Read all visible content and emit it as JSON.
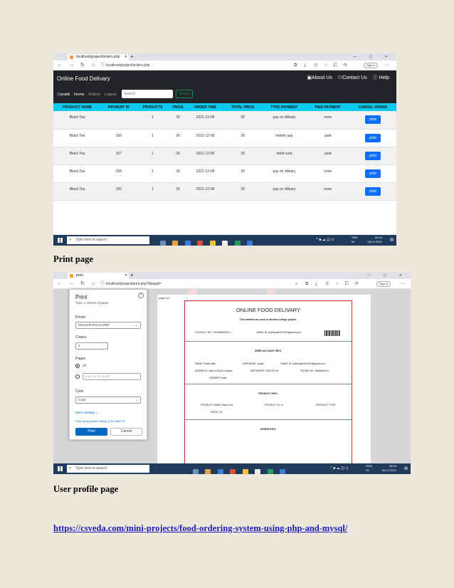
{
  "browser1": {
    "tab_title": "localhost/project/orders.php",
    "url": "localhost/project/orders.php",
    "sign_in": "Sign in"
  },
  "app": {
    "brand": "Online Food Delivary",
    "about": "About Us",
    "contact": "Contact Us",
    "help": "Help",
    "user": "pratik",
    "home": "Home",
    "orders": "Orders",
    "logout": "Logout",
    "search_placeholder": "Search",
    "search_button": "Search"
  },
  "orders_table": {
    "headers": [
      "PRODUCT NAME",
      "PAYMENT ID",
      "PRODUCTS",
      "PRICE",
      "ORDER TIME",
      "TOTAL PRICE",
      "TYPE PAYMENT",
      "PAID PAYMENT",
      "CANCEL ORDER"
    ],
    "rows": [
      [
        "Black Tea",
        "",
        "1",
        "30",
        "2021-12-08",
        "30",
        "pay on dilivary",
        "none",
        "print"
      ],
      [
        "Black Tea",
        "156",
        "1",
        "30",
        "2021-12-08",
        "30",
        "mobile pay",
        "paid",
        "print"
      ],
      [
        "Black Tea",
        "157",
        "1",
        "30",
        "2021-12-08",
        "30",
        "debit card",
        "paid",
        "print"
      ],
      [
        "Black Tea",
        "158",
        "1",
        "30",
        "2021-12-08",
        "30",
        "pay on dilivary",
        "none",
        "print"
      ],
      [
        "Black Tea",
        "159",
        "1",
        "30",
        "2021-12-08",
        "30",
        "pay on dilivary",
        "none",
        "print"
      ]
    ]
  },
  "taskbar": {
    "search": "Type here to search",
    "lang": "ENG",
    "region": "IN",
    "time1": "08:18",
    "date": "08-12-2021",
    "time2": "08:19"
  },
  "caption_print": "Print page",
  "browser2": {
    "tab_title": "print",
    "url": "localhost/project/print.php?0payid="
  },
  "print_dialog": {
    "title": "Print",
    "subtitle": "Total: 2 sheets of paper",
    "printer_label": "Printer",
    "printer_value": "Microsoft Print to PDF",
    "copies_label": "Copies",
    "copies_value": "1",
    "pages_label": "Pages",
    "pages_all": "All",
    "pages_range_placeholder": "e.g. 1-5, 8, 11-13",
    "color_label": "Color",
    "color_value": "Color",
    "more_settings": "More settings",
    "system_dialog": "Print using system dialog (Ctrl+Shift+P)",
    "print_button": "Print",
    "cancel_button": "Cancel"
  },
  "preview": {
    "page_no": "page 1/2",
    "title": "ONLINE FOOD DELIVARY",
    "subtitle": "This website are used in student college project.",
    "contact": "CONTACT NO: +919665626421",
    "gmail": "GMAIL ID: pratikpatil112001@gmail.com",
    "section_user": "USER ACCOUNT INFO.",
    "name": "NAME: Pratik patil",
    "username": "USERNAME: pratik",
    "user_gmail": "GMAIL ID: pratikpatil112001@gmail.com",
    "address": "ADDRESS: Jamb 415104 indapur",
    "birthdate": "BIRTHDATE: 0000-00-00",
    "phone": "PHONE NO: 9665626421",
    "gender": "GENDER: Male",
    "section_product": "PRODUCT INFO.",
    "product_name": "PRODUCT NAME: Black Tea",
    "product_id": "PRODUCT ID: 6",
    "product_type": "PRODUCT TYPE:",
    "price": "PRICE: 30",
    "section_order": "ORDER INFO."
  },
  "caption_profile": "User profile page",
  "link": "https://csveda.com/mini-projects/food-ordering-system-using-php-and-mysql/"
}
